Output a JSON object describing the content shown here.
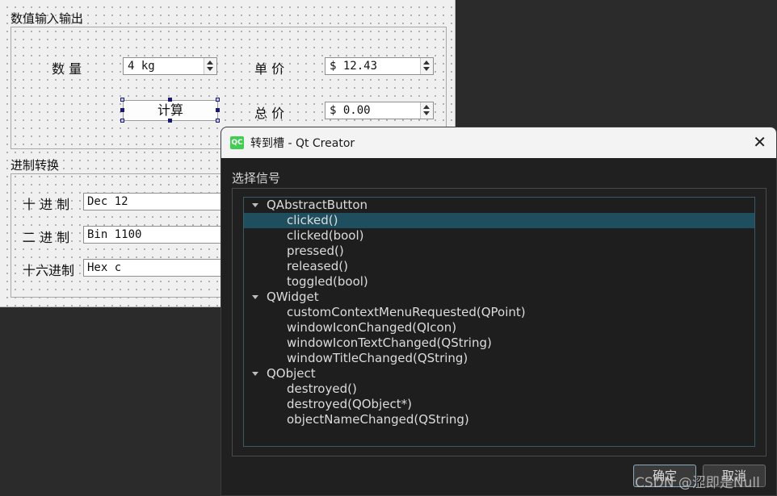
{
  "form": {
    "group1_title": "数值输入输出",
    "qty_label": "数 量",
    "qty_value": "4 kg",
    "price_label": "单 价",
    "price_value": "$ 12.43",
    "calc_button": "计算",
    "total_label": "总 价",
    "total_value": "$ 0.00",
    "group2_title": "进制转换",
    "dec_label": "十 进 制",
    "dec_value": "Dec 12",
    "bin_label": "二 进 制",
    "bin_value": "Bin 1100",
    "hex_label": "十六进制",
    "hex_value": "Hex c"
  },
  "dialog": {
    "title": "转到槽 - Qt Creator",
    "logo_text": "QC",
    "close_glyph": "✕",
    "select_signal_label": "选择信号",
    "tree": [
      {
        "label": "QAbstractButton",
        "level": 0
      },
      {
        "label": "clicked()",
        "level": 1,
        "selected": true
      },
      {
        "label": "clicked(bool)",
        "level": 1
      },
      {
        "label": "pressed()",
        "level": 1
      },
      {
        "label": "released()",
        "level": 1
      },
      {
        "label": "toggled(bool)",
        "level": 1
      },
      {
        "label": "QWidget",
        "level": 0
      },
      {
        "label": "customContextMenuRequested(QPoint)",
        "level": 1
      },
      {
        "label": "windowIconChanged(QIcon)",
        "level": 1
      },
      {
        "label": "windowIconTextChanged(QString)",
        "level": 1
      },
      {
        "label": "windowTitleChanged(QString)",
        "level": 1
      },
      {
        "label": "QObject",
        "level": 0
      },
      {
        "label": "destroyed()",
        "level": 1
      },
      {
        "label": "destroyed(QObject*)",
        "level": 1
      },
      {
        "label": "objectNameChanged(QString)",
        "level": 1
      }
    ],
    "ok_button": "确定",
    "cancel_button": "取消"
  },
  "watermark": "CSDN @涩即是Null",
  "colors": {
    "selection": "#1f4f5e",
    "qt_green": "#41cd52"
  }
}
